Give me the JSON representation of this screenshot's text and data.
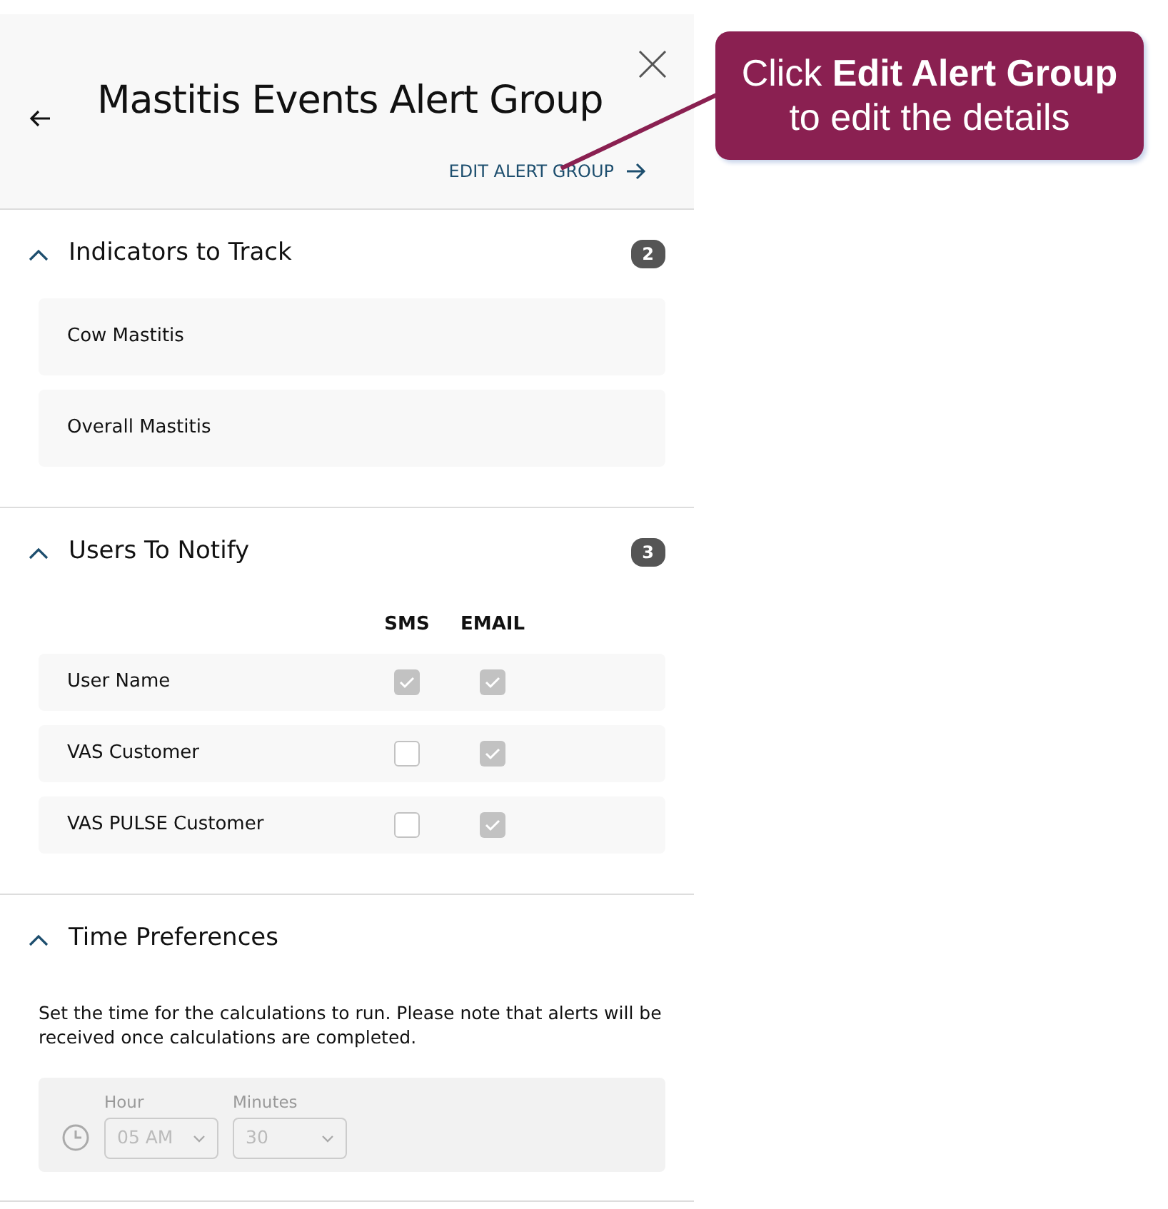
{
  "panel": {
    "title": "Mastitis Events Alert Group",
    "edit_link": "EDIT ALERT GROUP"
  },
  "indicators": {
    "title": "Indicators to Track",
    "expanded": true,
    "count": "2",
    "items": [
      "Cow Mastitis",
      "Overall Mastitis"
    ]
  },
  "users": {
    "title": "Users To Notify",
    "expanded": true,
    "count": "3",
    "columns": [
      "SMS",
      "EMAIL"
    ],
    "rows": [
      {
        "name": "User Name",
        "sms": true,
        "email": true
      },
      {
        "name": "VAS Customer",
        "sms": false,
        "email": true
      },
      {
        "name": "VAS PULSE Customer",
        "sms": false,
        "email": true
      }
    ]
  },
  "time": {
    "title": "Time Preferences",
    "expanded": true,
    "note": "Set the time for the calculations to run. Please note that alerts will be received once calculations are completed.",
    "disabled": true,
    "fields": [
      {
        "label": "Hour",
        "value": "05 AM"
      },
      {
        "label": "Minutes",
        "value": "30"
      }
    ]
  },
  "callout": {
    "text": "Click **Edit Alert Group**",
    "subtext": "to edit the details"
  }
}
